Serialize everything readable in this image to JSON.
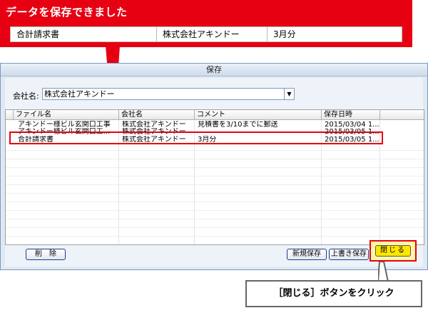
{
  "callout_top": {
    "title": "データを保存できました",
    "row": [
      "合計請求書",
      "株式会社アキンドー",
      "3月分"
    ]
  },
  "dialog": {
    "title": "保存",
    "company_label": "会社名:",
    "company_value": "株式会社アキンドー",
    "columns": [
      "ファイル名",
      "会社名",
      "コメント",
      "保存日時"
    ],
    "rows": [
      [
        "アキンドー様ビル玄関口工事",
        "株式会社アキンドー",
        "見積書を3/10までに郵送",
        "2015/03/04 1..."
      ],
      [
        "アキンドー様ビル玄関口工...",
        "株式会社アキンドー",
        "",
        "2015/03/05 1..."
      ],
      [
        "合計請求書",
        "株式会社アキンドー",
        "3月分",
        "2015/03/05 1..."
      ]
    ],
    "buttons": {
      "delete": "削　除",
      "new_save": "新規保存",
      "overwrite": "上書き保存",
      "close": "閉じる"
    }
  },
  "callout_bottom": "［閉じる］ボタンをクリック",
  "colors": {
    "accent_red": "#e60012",
    "close_yellow": "#ffe600"
  }
}
